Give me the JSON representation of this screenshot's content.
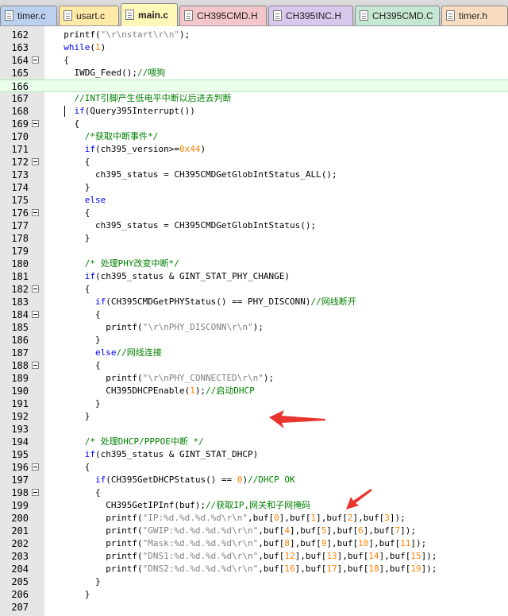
{
  "tabs": [
    {
      "label": "timer.c",
      "active": false,
      "color": "#bcd0f0",
      "name": "tab-timer-c"
    },
    {
      "label": "usart.c",
      "active": false,
      "color": "#ffe9a6",
      "name": "tab-usart-c"
    },
    {
      "label": "main.c",
      "active": true,
      "color": "#fff7b8",
      "name": "tab-main-c"
    },
    {
      "label": "CH395CMD.H",
      "active": false,
      "color": "#f4c6cc",
      "name": "tab-ch395cmd-h"
    },
    {
      "label": "CH395INC.H",
      "active": false,
      "color": "#d9c8ee",
      "name": "tab-ch395inc-h"
    },
    {
      "label": "CH395CMD.C",
      "active": false,
      "color": "#c6e7d4",
      "name": "tab-ch395cmd-c"
    },
    {
      "label": "timer.h",
      "active": false,
      "color": "#f8dcc0",
      "name": "tab-timer-h"
    }
  ],
  "colors": {
    "keyword": "#0000ff",
    "string": "#808080",
    "comment": "#008000",
    "number": "#ff8000",
    "plain": "#000000",
    "arrow": "#e8352e"
  },
  "editor": {
    "lines": [
      {
        "n": "162",
        "fold": false,
        "cur": false,
        "t": [
          [
            "pl",
            "  printf("
          ],
          [
            "str",
            "\"\\r\\nstart\\r\\n\""
          ],
          [
            "pl",
            ");"
          ]
        ]
      },
      {
        "n": "163",
        "fold": false,
        "cur": false,
        "t": [
          [
            "kw",
            "  while"
          ],
          [
            "pl",
            "("
          ],
          [
            "num",
            "1"
          ],
          [
            "pl",
            ")"
          ]
        ]
      },
      {
        "n": "164",
        "fold": true,
        "cur": false,
        "t": [
          [
            "pl",
            "  {"
          ]
        ]
      },
      {
        "n": "165",
        "fold": false,
        "cur": false,
        "t": [
          [
            "pl",
            "    IWDG_Feed();"
          ],
          [
            "cm",
            "//喂狗"
          ]
        ]
      },
      {
        "n": "166",
        "fold": false,
        "cur": true,
        "t": []
      },
      {
        "n": "167",
        "fold": false,
        "cur": false,
        "t": [
          [
            "cm",
            "    //INT引脚产生低电平中断以后进去判断"
          ]
        ]
      },
      {
        "n": "168",
        "fold": false,
        "cur": false,
        "t": [
          [
            "kw",
            "    if"
          ],
          [
            "pl",
            "(Query395Interrupt())"
          ]
        ]
      },
      {
        "n": "169",
        "fold": true,
        "cur": false,
        "t": [
          [
            "pl",
            "    {"
          ]
        ]
      },
      {
        "n": "170",
        "fold": false,
        "cur": false,
        "t": [
          [
            "cm",
            "      /*获取中断事件*/"
          ]
        ]
      },
      {
        "n": "171",
        "fold": false,
        "cur": false,
        "t": [
          [
            "kw",
            "      if"
          ],
          [
            "pl",
            "(ch395_version>="
          ],
          [
            "num",
            "0x44"
          ],
          [
            "pl",
            ")"
          ]
        ]
      },
      {
        "n": "172",
        "fold": true,
        "cur": false,
        "t": [
          [
            "pl",
            "      {"
          ]
        ]
      },
      {
        "n": "173",
        "fold": false,
        "cur": false,
        "t": [
          [
            "pl",
            "        ch395_status = CH395CMDGetGlobIntStatus_ALL();"
          ]
        ]
      },
      {
        "n": "174",
        "fold": false,
        "cur": false,
        "t": [
          [
            "pl",
            "      }"
          ]
        ]
      },
      {
        "n": "175",
        "fold": false,
        "cur": false,
        "t": [
          [
            "kw",
            "      else"
          ]
        ]
      },
      {
        "n": "176",
        "fold": true,
        "cur": false,
        "t": [
          [
            "pl",
            "      {"
          ]
        ]
      },
      {
        "n": "177",
        "fold": false,
        "cur": false,
        "t": [
          [
            "pl",
            "        ch395_status = CH395CMDGetGlobIntStatus();"
          ]
        ]
      },
      {
        "n": "178",
        "fold": false,
        "cur": false,
        "t": [
          [
            "pl",
            "      }"
          ]
        ]
      },
      {
        "n": "179",
        "fold": false,
        "cur": false,
        "t": []
      },
      {
        "n": "180",
        "fold": false,
        "cur": false,
        "t": [
          [
            "cm",
            "      /* 处理PHY改变中断*/"
          ]
        ]
      },
      {
        "n": "181",
        "fold": false,
        "cur": false,
        "t": [
          [
            "kw",
            "      if"
          ],
          [
            "pl",
            "(ch395_status & GINT_STAT_PHY_CHANGE)"
          ]
        ]
      },
      {
        "n": "182",
        "fold": true,
        "cur": false,
        "t": [
          [
            "pl",
            "      {"
          ]
        ]
      },
      {
        "n": "183",
        "fold": false,
        "cur": false,
        "t": [
          [
            "kw",
            "        if"
          ],
          [
            "pl",
            "(CH395CMDGetPHYStatus() == PHY_DISCONN)"
          ],
          [
            "cm",
            "//网线断开"
          ]
        ]
      },
      {
        "n": "184",
        "fold": true,
        "cur": false,
        "t": [
          [
            "pl",
            "        {"
          ]
        ]
      },
      {
        "n": "185",
        "fold": false,
        "cur": false,
        "t": [
          [
            "pl",
            "          printf("
          ],
          [
            "str",
            "\"\\r\\nPHY_DISCONN\\r\\n\""
          ],
          [
            "pl",
            ");"
          ]
        ]
      },
      {
        "n": "186",
        "fold": false,
        "cur": false,
        "t": [
          [
            "pl",
            "        }"
          ]
        ]
      },
      {
        "n": "187",
        "fold": false,
        "cur": false,
        "t": [
          [
            "kw",
            "        else"
          ],
          [
            "cm",
            "//网线连接"
          ]
        ]
      },
      {
        "n": "188",
        "fold": true,
        "cur": false,
        "t": [
          [
            "pl",
            "        {"
          ]
        ]
      },
      {
        "n": "189",
        "fold": false,
        "cur": false,
        "t": [
          [
            "pl",
            "          printf("
          ],
          [
            "str",
            "\"\\r\\nPHY_CONNECTED\\r\\n\""
          ],
          [
            "pl",
            ");"
          ]
        ]
      },
      {
        "n": "190",
        "fold": false,
        "cur": false,
        "t": [
          [
            "pl",
            "          CH395DHCPEnable("
          ],
          [
            "num",
            "1"
          ],
          [
            "pl",
            ");"
          ],
          [
            "cm",
            "//启动DHCP"
          ]
        ]
      },
      {
        "n": "191",
        "fold": false,
        "cur": false,
        "t": [
          [
            "pl",
            "        }"
          ]
        ]
      },
      {
        "n": "192",
        "fold": false,
        "cur": false,
        "t": [
          [
            "pl",
            "      }"
          ]
        ]
      },
      {
        "n": "193",
        "fold": false,
        "cur": false,
        "t": []
      },
      {
        "n": "194",
        "fold": false,
        "cur": false,
        "t": [
          [
            "cm",
            "      /* 处理DHCP/PPPOE中断 */"
          ]
        ]
      },
      {
        "n": "195",
        "fold": false,
        "cur": false,
        "t": [
          [
            "kw",
            "      if"
          ],
          [
            "pl",
            "(ch395_status & GINT_STAT_DHCP)"
          ]
        ]
      },
      {
        "n": "196",
        "fold": true,
        "cur": false,
        "t": [
          [
            "pl",
            "      {"
          ]
        ]
      },
      {
        "n": "197",
        "fold": false,
        "cur": false,
        "t": [
          [
            "kw",
            "        if"
          ],
          [
            "pl",
            "(CH395GetDHCPStatus() == "
          ],
          [
            "num",
            "0"
          ],
          [
            "pl",
            ")"
          ],
          [
            "cm",
            "//DHCP OK"
          ]
        ]
      },
      {
        "n": "198",
        "fold": true,
        "cur": false,
        "t": [
          [
            "pl",
            "        {"
          ]
        ]
      },
      {
        "n": "199",
        "fold": false,
        "cur": false,
        "t": [
          [
            "pl",
            "          CH395GetIPInf(buf);"
          ],
          [
            "cm",
            "//获取IP,网关和子网掩码"
          ]
        ]
      },
      {
        "n": "200",
        "fold": false,
        "cur": false,
        "t": [
          [
            "pl",
            "          printf("
          ],
          [
            "str",
            "\"IP:%d.%d.%d.%d\\r\\n\""
          ],
          [
            "pl",
            ",buf["
          ],
          [
            "num",
            "0"
          ],
          [
            "pl",
            "],buf["
          ],
          [
            "num",
            "1"
          ],
          [
            "pl",
            "],buf["
          ],
          [
            "num",
            "2"
          ],
          [
            "pl",
            "],buf["
          ],
          [
            "num",
            "3"
          ],
          [
            "pl",
            "]);"
          ]
        ]
      },
      {
        "n": "201",
        "fold": false,
        "cur": false,
        "t": [
          [
            "pl",
            "          printf("
          ],
          [
            "str",
            "\"GWIP:%d.%d.%d.%d\\r\\n\""
          ],
          [
            "pl",
            ",buf["
          ],
          [
            "num",
            "4"
          ],
          [
            "pl",
            "],buf["
          ],
          [
            "num",
            "5"
          ],
          [
            "pl",
            "],buf["
          ],
          [
            "num",
            "6"
          ],
          [
            "pl",
            "],buf["
          ],
          [
            "num",
            "7"
          ],
          [
            "pl",
            "]);"
          ]
        ]
      },
      {
        "n": "202",
        "fold": false,
        "cur": false,
        "t": [
          [
            "pl",
            "          printf("
          ],
          [
            "str",
            "\"Mask:%d.%d.%d.%d\\r\\n\""
          ],
          [
            "pl",
            ",buf["
          ],
          [
            "num",
            "8"
          ],
          [
            "pl",
            "],buf["
          ],
          [
            "num",
            "9"
          ],
          [
            "pl",
            "],buf["
          ],
          [
            "num",
            "10"
          ],
          [
            "pl",
            "],buf["
          ],
          [
            "num",
            "11"
          ],
          [
            "pl",
            "]);"
          ]
        ]
      },
      {
        "n": "203",
        "fold": false,
        "cur": false,
        "t": [
          [
            "pl",
            "          printf("
          ],
          [
            "str",
            "\"DNS1:%d.%d.%d.%d\\r\\n\""
          ],
          [
            "pl",
            ",buf["
          ],
          [
            "num",
            "12"
          ],
          [
            "pl",
            "],buf["
          ],
          [
            "num",
            "13"
          ],
          [
            "pl",
            "],buf["
          ],
          [
            "num",
            "14"
          ],
          [
            "pl",
            "],buf["
          ],
          [
            "num",
            "15"
          ],
          [
            "pl",
            "]);"
          ]
        ]
      },
      {
        "n": "204",
        "fold": false,
        "cur": false,
        "t": [
          [
            "pl",
            "          printf("
          ],
          [
            "str",
            "\"DNS2:%d.%d.%d.%d\\r\\n\""
          ],
          [
            "pl",
            ",buf["
          ],
          [
            "num",
            "16"
          ],
          [
            "pl",
            "],buf["
          ],
          [
            "num",
            "17"
          ],
          [
            "pl",
            "],buf["
          ],
          [
            "num",
            "18"
          ],
          [
            "pl",
            "],buf["
          ],
          [
            "num",
            "19"
          ],
          [
            "pl",
            "]);"
          ]
        ]
      },
      {
        "n": "205",
        "fold": false,
        "cur": false,
        "t": [
          [
            "pl",
            "        }"
          ]
        ]
      },
      {
        "n": "206",
        "fold": false,
        "cur": false,
        "t": [
          [
            "pl",
            "      }"
          ]
        ]
      },
      {
        "n": "207",
        "fold": false,
        "cur": false,
        "t": []
      }
    ]
  }
}
